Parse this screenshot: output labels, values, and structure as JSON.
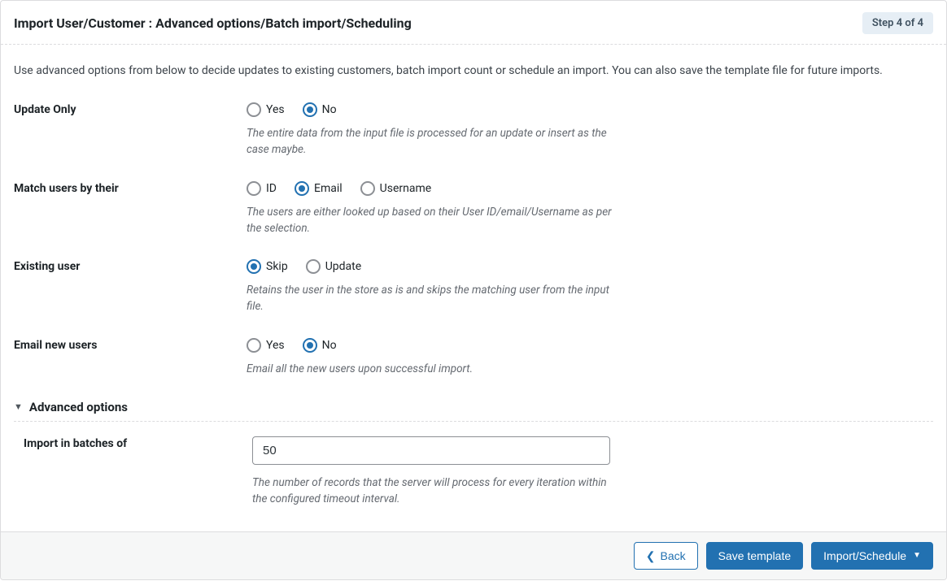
{
  "header": {
    "title": "Import User/Customer : Advanced options/Batch import/Scheduling",
    "step_badge": "Step 4 of 4"
  },
  "intro": "Use advanced options from below to decide updates to existing customers, batch import count or schedule an import. You can also save the template file for future imports.",
  "fields": {
    "update_only": {
      "label": "Update Only",
      "options": {
        "yes": "Yes",
        "no": "No"
      },
      "selected": "no",
      "help": "The entire data from the input file is processed for an update or insert as the case maybe."
    },
    "match_users": {
      "label": "Match users by their",
      "options": {
        "id": "ID",
        "email": "Email",
        "username": "Username"
      },
      "selected": "email",
      "help": "The users are either looked up based on their User ID/email/Username as per the selection."
    },
    "existing_user": {
      "label": "Existing user",
      "options": {
        "skip": "Skip",
        "update": "Update"
      },
      "selected": "skip",
      "help": "Retains the user in the store as is and skips the matching user from the input file."
    },
    "email_new": {
      "label": "Email new users",
      "options": {
        "yes": "Yes",
        "no": "No"
      },
      "selected": "no",
      "help": "Email all the new users upon successful import."
    }
  },
  "advanced": {
    "title": "Advanced options",
    "batch": {
      "label": "Import in batches of",
      "value": "50",
      "help": "The number of records that the server will process for every iteration within the configured timeout interval."
    }
  },
  "footer": {
    "back": "Back",
    "save_template": "Save template",
    "import_schedule": "Import/Schedule"
  }
}
